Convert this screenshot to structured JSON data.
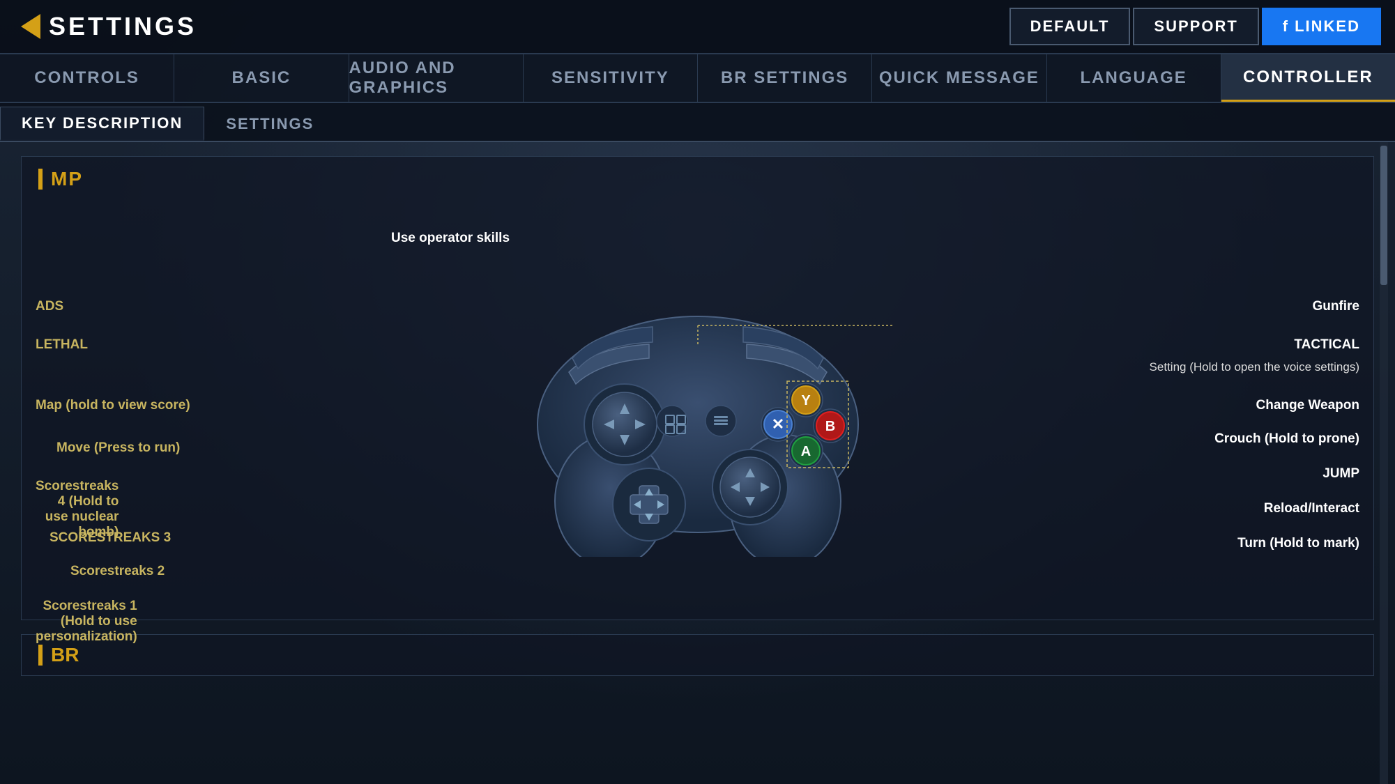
{
  "header": {
    "title": "SETTINGS",
    "back_label": "SETTINGS",
    "buttons": {
      "default": "DEFAULT",
      "support": "SUPPORT",
      "linked": "LINKED"
    }
  },
  "nav_tabs": [
    {
      "id": "controls",
      "label": "CONTROLS",
      "active": false
    },
    {
      "id": "basic",
      "label": "BASIC",
      "active": false
    },
    {
      "id": "audio_graphics",
      "label": "AUDIO AND GRAPHICS",
      "active": false
    },
    {
      "id": "sensitivity",
      "label": "SENSITIVITY",
      "active": false
    },
    {
      "id": "br_settings",
      "label": "BR SETTINGS",
      "active": false
    },
    {
      "id": "quick_message",
      "label": "QUICK MESSAGE",
      "active": false
    },
    {
      "id": "language",
      "label": "LANGUAGE",
      "active": false
    },
    {
      "id": "controller",
      "label": "CONTROLLER",
      "active": true
    }
  ],
  "sub_tabs": [
    {
      "id": "key_description",
      "label": "KEY DESCRIPTION",
      "active": true
    },
    {
      "id": "settings",
      "label": "SETTINGS",
      "active": false
    }
  ],
  "sections": {
    "mp": {
      "title": "MP",
      "labels_left": {
        "use_operator_skills": "Use operator skills",
        "ads": "ADS",
        "lethal": "LETHAL",
        "map": "Map (hold to view score)",
        "move": "Move (Press to run)",
        "scorestreaks4": "Scorestreaks 4 (Hold to use nuclear bomb)",
        "scorestreaks3": "SCORESTREAKS 3",
        "scorestreaks2": "Scorestreaks 2",
        "scorestreaks1": "Scorestreaks 1 (Hold to use personalization)"
      },
      "labels_right": {
        "gunfire": "Gunfire",
        "tactical": "TACTICAL",
        "setting": "Setting (Hold to open the voice settings)",
        "change_weapon": "Change Weapon",
        "crouch": "Crouch (Hold to prone)",
        "jump": "JUMP",
        "reload": "Reload/Interact",
        "turn": "Turn (Hold to mark)"
      }
    },
    "br": {
      "title": "BR"
    }
  },
  "colors": {
    "accent": "#d4a017",
    "active_tab_bg": "rgba(40,55,75,0.8)",
    "label_left_color": "#c8b560",
    "label_right_color": "#ffffff",
    "bg_dark": "#0d1520",
    "controller_body": "#2a3a55",
    "btn_y_color": "#d4a017",
    "btn_b_color": "#e02020",
    "btn_x_color": "#4a80d0",
    "btn_a_color": "#20a040"
  }
}
